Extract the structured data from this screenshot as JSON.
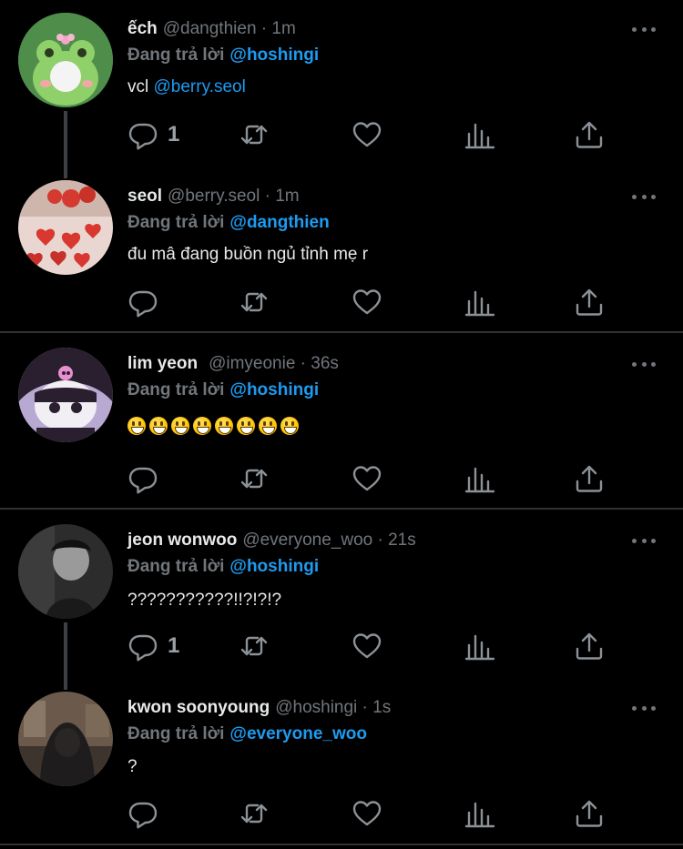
{
  "reply_prefix": "Đang trả lời",
  "tweets": [
    {
      "name": "ếch",
      "handle": "@dangthien · 1m",
      "reply_to": "@hoshingi",
      "text_plain": "vcl ",
      "text_mention": "@berry.seol",
      "reply_count": "1",
      "avatar": "frog-avatar"
    },
    {
      "name": "seol",
      "handle": "@berry.seol · 1m",
      "reply_to": "@dangthien",
      "text_plain": "đu mâ đang buồn ngủ tỉnh mẹ r",
      "reply_count": "",
      "avatar": "strawberry-avatar"
    },
    {
      "name": "lim yeon",
      "handle": "@imyeonie · 36s",
      "reply_to": "@hoshingi",
      "emoji_count": 8,
      "emoji_name": "grinning-face-emoji",
      "reply_count": "",
      "avatar": "kuromi-avatar"
    },
    {
      "name": "jeon wonwoo",
      "handle": "@everyone_woo · 21s",
      "reply_to": "@hoshingi",
      "text_plain": "???????????!!?!?!?",
      "reply_count": "1",
      "avatar": "grayscale-person-avatar"
    },
    {
      "name": "kwon soonyoung",
      "handle": "@hoshingi · 1s",
      "reply_to": "@everyone_woo",
      "text_plain": "?",
      "reply_count": "",
      "avatar": "hooded-person-avatar"
    }
  ],
  "icons": {
    "reply": "reply-icon",
    "retweet": "retweet-icon",
    "like": "heart-icon",
    "views": "views-icon",
    "share": "share-icon",
    "more": "more-icon"
  },
  "colors": {
    "background": "#000000",
    "text": "#e7e9ea",
    "muted": "#71767b",
    "mention": "#1d9bf0",
    "divider": "#2f3336"
  }
}
